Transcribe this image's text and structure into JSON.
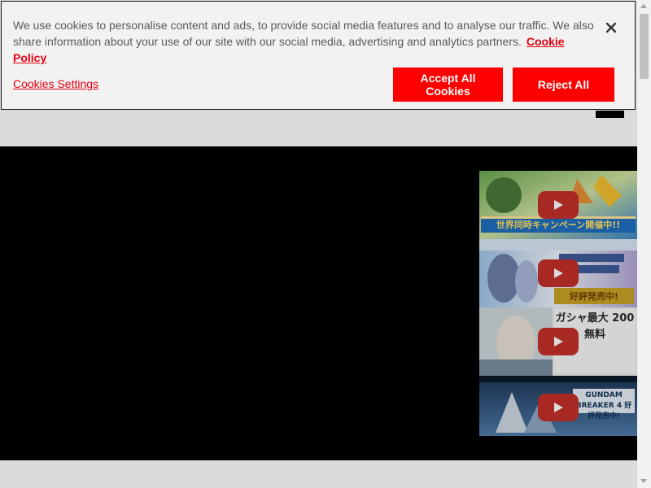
{
  "cookie_banner": {
    "message": "We use cookies to personalise content and ads, to provide social media features and to analyse our traffic. We also share information about your use of our site with our social media, advertising and analytics partners.",
    "policy_link": "Cookie Policy",
    "settings_link": "Cookies Settings",
    "accept_label": "Accept All Cookies",
    "reject_label": "Reject All",
    "close_icon": "close-icon"
  },
  "playlist": {
    "items": [
      {
        "title": "世界同時キャンペーン開催中!!",
        "icon": "play-icon"
      },
      {
        "title": "好評発売中!",
        "icon": "play-icon"
      },
      {
        "title": "ガシャ最大 200 無料",
        "icon": "play-icon"
      },
      {
        "title": "GUNDAM BREAKER 4 好評発売中!",
        "icon": "play-icon"
      }
    ]
  },
  "colors": {
    "accent_red": "#ff0000",
    "link_red": "#e60012",
    "banner_bg": "#f2f2f2",
    "stage_bg": "#000000",
    "play_button": "#c4302b"
  }
}
